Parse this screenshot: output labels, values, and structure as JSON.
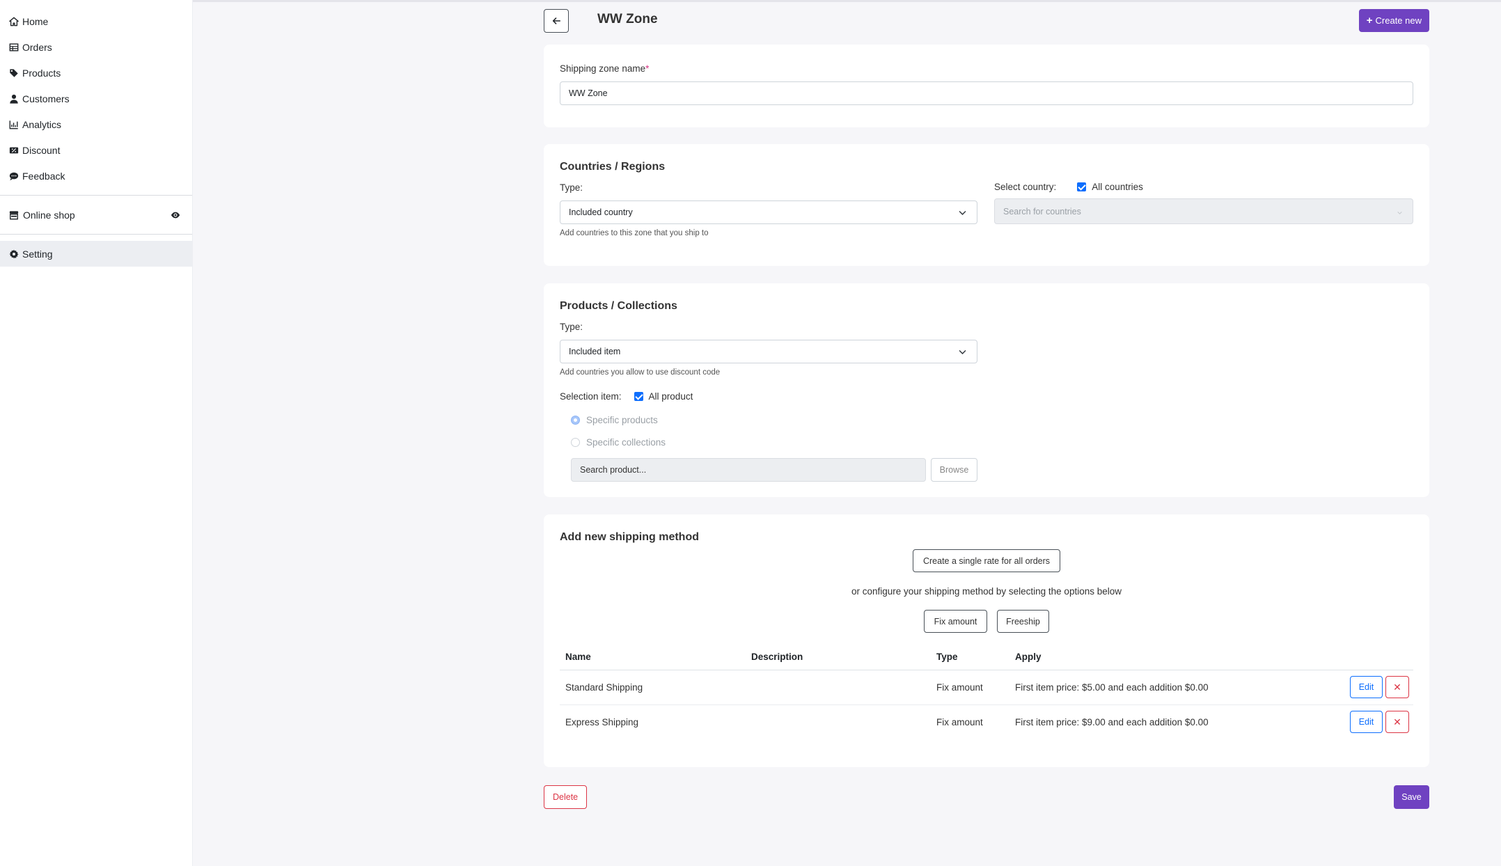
{
  "sidebar": {
    "items": [
      {
        "label": "Home",
        "icon": "home-icon"
      },
      {
        "label": "Orders",
        "icon": "table-icon"
      },
      {
        "label": "Products",
        "icon": "tag-icon"
      },
      {
        "label": "Customers",
        "icon": "user-icon"
      },
      {
        "label": "Analytics",
        "icon": "chart-icon"
      },
      {
        "label": "Discount",
        "icon": "discount-icon"
      },
      {
        "label": "Feedback",
        "icon": "comment-icon"
      }
    ],
    "shop": {
      "label": "Online shop",
      "icon": "store-icon",
      "toggle_icon": "eye-icon"
    },
    "setting": {
      "label": "Setting",
      "icon": "gear-icon"
    }
  },
  "header": {
    "title": "WW Zone",
    "create_label": "Create new"
  },
  "zone_name": {
    "label": "Shipping zone name",
    "required_mark": "*",
    "value": "WW Zone"
  },
  "countries": {
    "title": "Countries / Regions",
    "type_label": "Type:",
    "type_value": "Included country",
    "help": "Add countries to this zone that you ship to",
    "select_label": "Select country:",
    "all_label": "All countries",
    "search_placeholder": "Search for countries"
  },
  "products": {
    "title": "Products / Collections",
    "type_label": "Type:",
    "type_value": "Included item",
    "help": "Add countries you allow to use discount code",
    "selection_label": "Selection item:",
    "all_label": "All product",
    "radio_specific_products": "Specific products",
    "radio_specific_collections": "Specific collections",
    "search_placeholder": "Search product...",
    "browse_label": "Browse"
  },
  "shipping": {
    "title": "Add new shipping method",
    "single_rate_label": "Create a single rate for all orders",
    "or_text": "or configure your shipping method by selecting the options below",
    "fix_amount_label": "Fix amount",
    "freeship_label": "Freeship",
    "columns": [
      "Name",
      "Description",
      "Type",
      "Apply"
    ],
    "rows": [
      {
        "name": "Standard Shipping",
        "description": "",
        "type": "Fix amount",
        "apply": "First item price: $5.00 and each addition $0.00",
        "edit_label": "Edit"
      },
      {
        "name": "Express Shipping",
        "description": "",
        "type": "Fix amount",
        "apply": "First item price: $9.00 and each addition $0.00",
        "edit_label": "Edit"
      }
    ]
  },
  "footer": {
    "delete_label": "Delete",
    "save_label": "Save"
  },
  "colors": {
    "primary": "#6f42c1",
    "danger": "#dc3545",
    "link": "#0d6efd"
  }
}
